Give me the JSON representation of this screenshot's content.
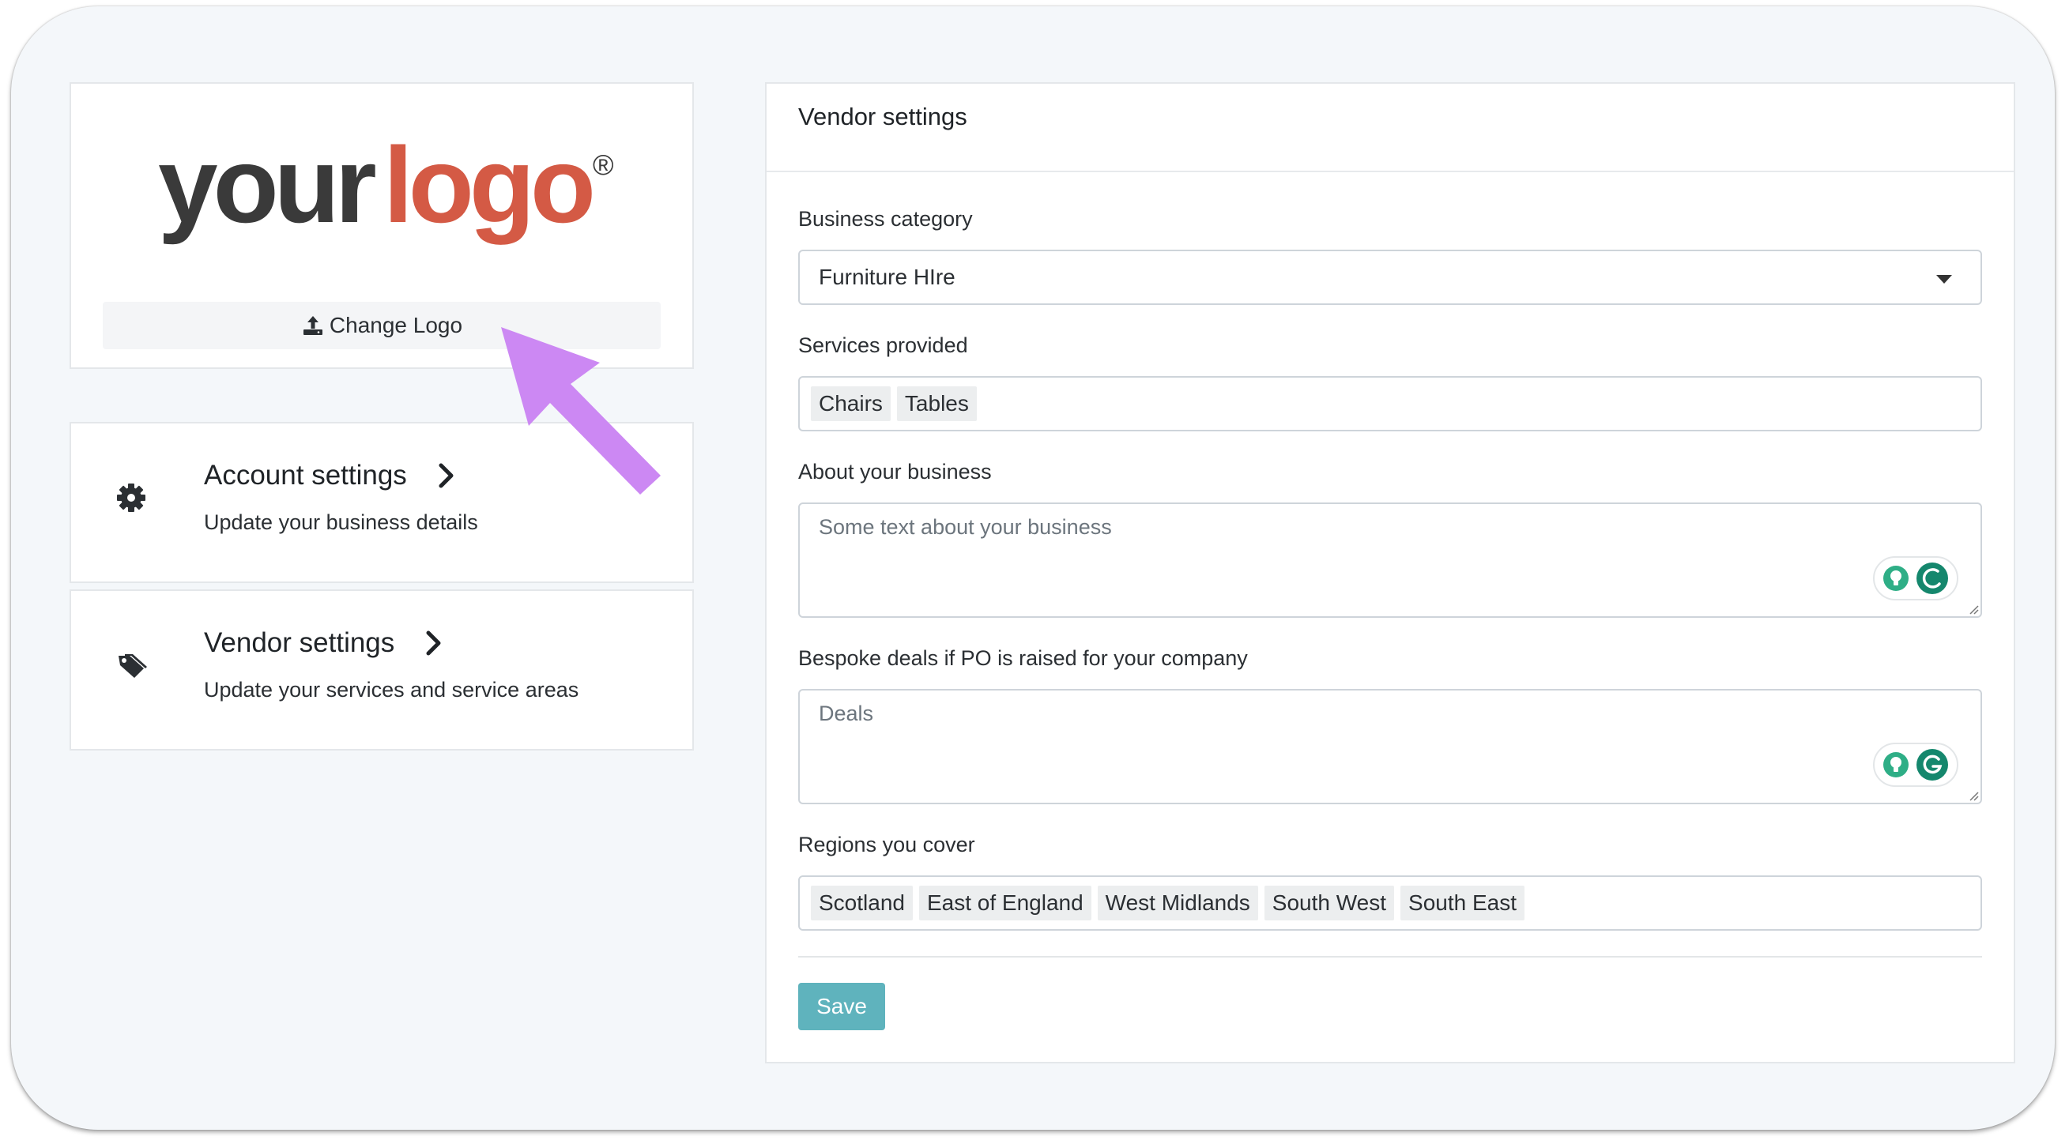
{
  "logo": {
    "word1": "your",
    "word2": "logo",
    "mark": "®",
    "alt": "your logo"
  },
  "change_logo": {
    "label": "Change Logo",
    "icon": "upload-icon"
  },
  "nav": [
    {
      "title": "Account settings",
      "subtitle": "Update your business details",
      "icon": "gear-icon"
    },
    {
      "title": "Vendor settings",
      "subtitle": "Update your services and service areas",
      "icon": "tags-icon"
    }
  ],
  "form": {
    "title": "Vendor settings",
    "business_category": {
      "label": "Business category",
      "value": "Furniture HIre"
    },
    "services": {
      "label": "Services provided",
      "tags": [
        "Chairs",
        "Tables"
      ]
    },
    "about": {
      "label": "About your business",
      "placeholder": "Some text about your business"
    },
    "deals": {
      "label": "Bespoke deals if PO is raised for your company",
      "placeholder": "Deals"
    },
    "regions": {
      "label": "Regions you cover",
      "tags": [
        "Scotland",
        "East of England",
        "West Midlands",
        "South West",
        "South East"
      ]
    },
    "save_label": "Save"
  },
  "colors": {
    "accent": "#5fb3bd",
    "logo_grey": "#3a3a3a",
    "logo_red": "#d45a45",
    "arrow": "#cc88f3",
    "grammarly_green": "#15876d"
  }
}
